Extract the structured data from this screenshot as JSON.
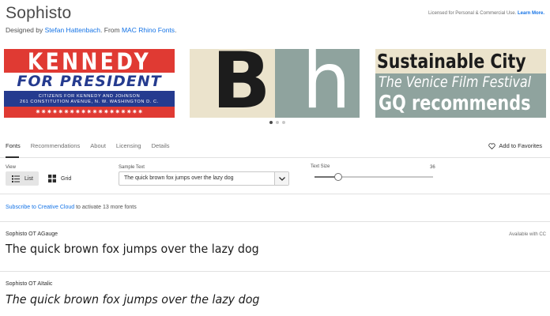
{
  "header": {
    "title": "Sophisto",
    "designed_by_prefix": "Designed by ",
    "designer": "Stefan Hattenbach",
    "from_prefix": ". From ",
    "foundry": "MAC Rhino Fonts",
    "foundry_suffix": ".",
    "license_text": "Licensed for Personal & Commercial Use. ",
    "learn_more": "Learn More."
  },
  "carousel": {
    "slides": [
      {
        "lines": [
          "KENNEDY",
          "FOR PRESIDENT",
          "CITIZENS FOR KENNEDY AND JOHNSON",
          "261 CONSTITUTION AVENUE, N. W. WASHINGTON D. C.",
          "✷✷✷✷✷✷✷✷✷✷✷✷✷✷✷✷✷✷✷"
        ]
      },
      {
        "lines": [
          "B",
          "h"
        ]
      },
      {
        "lines": [
          "Sustainable City",
          "The Venice Film Festival",
          "GQ recommends"
        ]
      }
    ],
    "active_index": 0,
    "colors": {
      "red": "#e03a33",
      "blue": "#253b8f",
      "cream": "#ebe3cc",
      "sage": "#8fa39e"
    }
  },
  "tabs": [
    {
      "label": "Fonts",
      "active": true
    },
    {
      "label": "Recommendations",
      "active": false
    },
    {
      "label": "About",
      "active": false
    },
    {
      "label": "Licensing",
      "active": false
    },
    {
      "label": "Details",
      "active": false
    }
  ],
  "favorites": {
    "label": "Add to Favorites",
    "icon": "heart-outline-icon"
  },
  "controls": {
    "view_label": "View",
    "list_label": "List",
    "grid_label": "Grid",
    "sample_label": "Sample Text",
    "sample_value": "The quick brown fox jumps over the lazy dog",
    "size_label": "Text Size",
    "size_value": "36",
    "size_fraction": 0.2
  },
  "subscribe": {
    "link": "Subscribe to Creative Cloud",
    "rest": " to activate 13 more fonts"
  },
  "fonts": [
    {
      "name": "Sophisto OT AGauge",
      "availability": "Available with CC",
      "sample": "The quick brown fox jumps over the lazy dog",
      "italic": false
    },
    {
      "name": "Sophisto OT AItalic",
      "availability": "",
      "sample": "The quick brown fox jumps over the lazy dog",
      "italic": true
    }
  ],
  "accent_color": "#1473e6"
}
